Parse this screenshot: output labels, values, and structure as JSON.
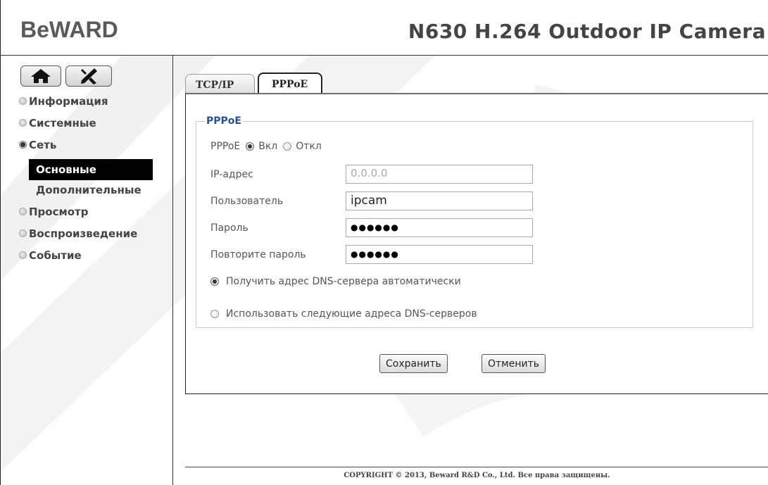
{
  "header": {
    "brand": "BeWARD",
    "title": "N630 H.264 Outdoor IP Camera"
  },
  "toolbar": {
    "home_icon": "home-icon",
    "settings_icon": "tools-icon"
  },
  "sidebar": {
    "items": [
      {
        "label": "Информация",
        "expanded": false
      },
      {
        "label": "Системные",
        "expanded": false
      },
      {
        "label": "Сеть",
        "expanded": true
      },
      {
        "label": "Просмотр",
        "expanded": false
      },
      {
        "label": "Воспроизведение",
        "expanded": false
      },
      {
        "label": "Событие",
        "expanded": false
      }
    ],
    "network_sub": [
      {
        "label": "Основные",
        "active": true
      },
      {
        "label": "Дополнительные",
        "active": false
      }
    ]
  },
  "tabs": [
    {
      "label": "TCP/IP",
      "active": false
    },
    {
      "label": "PPPoE",
      "active": true
    }
  ],
  "form": {
    "legend": "PPPoE",
    "pppoe_label": "PPPoE",
    "on_label": "Вкл",
    "off_label": "Откл",
    "pppoe_enabled": true,
    "ip_label": "IP-адрес",
    "ip_value": "0.0.0.0",
    "user_label": "Пользователь",
    "user_value": "ipcam",
    "password_label": "Пароль",
    "password_mask": "●●●●●●",
    "repeat_label": "Повторите пароль",
    "repeat_mask": "●●●●●●",
    "dns_auto_label": "Получить адрес DNS-сервера автоматически",
    "dns_manual_label": "Использовать следующие адреса DNS-серверов",
    "dns_auto_selected": true
  },
  "actions": {
    "save": "Сохранить",
    "cancel": "Отменить"
  },
  "footer": {
    "copyright": "COPYRIGHT © 2013, Beward R&D Co., Ltd. Все права защищены."
  },
  "colors": {
    "legend": "#2a4f8a",
    "active_nav_bg": "#000000",
    "watermark": "#efefef"
  }
}
